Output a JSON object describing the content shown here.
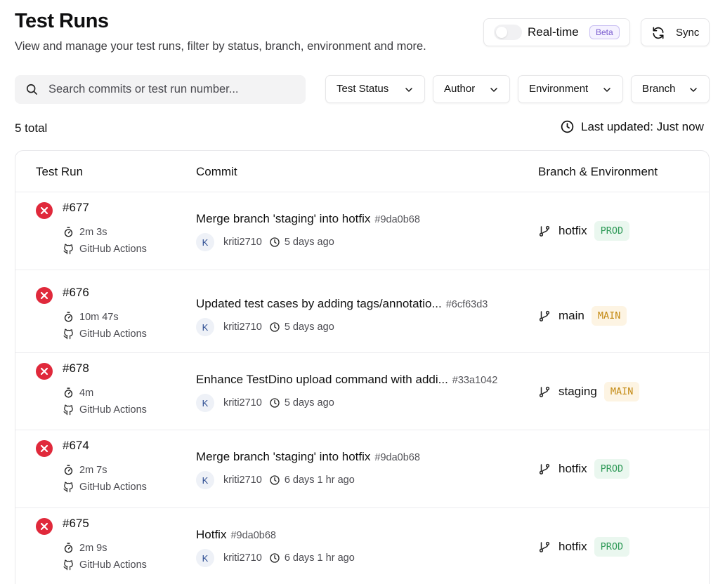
{
  "header": {
    "title": "Test Runs",
    "subtitle": "View and manage your test runs, filter by status, branch, environment and more."
  },
  "realtime": {
    "label": "Real-time",
    "badge": "Beta",
    "enabled": false
  },
  "sync": {
    "label": "Sync"
  },
  "search": {
    "placeholder": "Search commits or test run number..."
  },
  "filters": [
    "Test Status",
    "Author",
    "Environment",
    "Branch"
  ],
  "summary": {
    "total": "5 total",
    "last_updated": "Last updated: Just now"
  },
  "table": {
    "columns": [
      "Test Run",
      "Commit",
      "Branch & Environment"
    ],
    "rows": [
      {
        "run": "#677",
        "duration": "2m 3s",
        "provider": "GitHub Actions",
        "status": "failed",
        "commit_message": "Merge branch 'staging' into hotfix",
        "commit_hash": "#9da0b68",
        "author_initial": "K",
        "author": "kriti2710",
        "time": "5 days ago",
        "branch": "hotfix",
        "environment": "PROD"
      },
      {
        "run": "#676",
        "duration": "10m 47s",
        "provider": "GitHub Actions",
        "status": "failed",
        "commit_message": "Updated test cases by adding tags/annotatio...",
        "commit_hash": "#6cf63d3",
        "author_initial": "K",
        "author": "kriti2710",
        "time": "5 days ago",
        "branch": "main",
        "environment": "MAIN"
      },
      {
        "run": "#678",
        "duration": "4m",
        "provider": "GitHub Actions",
        "status": "failed",
        "commit_message": "Enhance TestDino upload command with addi...",
        "commit_hash": "#33a1042",
        "author_initial": "K",
        "author": "kriti2710",
        "time": "5 days ago",
        "branch": "staging",
        "environment": "MAIN"
      },
      {
        "run": "#674",
        "duration": "2m 7s",
        "provider": "GitHub Actions",
        "status": "failed",
        "commit_message": "Merge branch 'staging' into hotfix",
        "commit_hash": "#9da0b68",
        "author_initial": "K",
        "author": "kriti2710",
        "time": "6 days 1 hr ago",
        "branch": "hotfix",
        "environment": "PROD"
      },
      {
        "run": "#675",
        "duration": "2m 9s",
        "provider": "GitHub Actions",
        "status": "failed",
        "commit_message": "Hotfix",
        "commit_hash": "#9da0b68",
        "author_initial": "K",
        "author": "kriti2710",
        "time": "6 days 1 hr ago",
        "branch": "hotfix",
        "environment": "PROD"
      }
    ]
  },
  "colors": {
    "failed": "#e0293b",
    "prod_badge_bg": "#eaf7ef",
    "prod_badge_text": "#2f9a58",
    "main_badge_bg": "#fdf4e3",
    "main_badge_text": "#c48a13",
    "beta_badge_text": "#7a5ccf"
  },
  "icons": {
    "search": "search-icon",
    "sync": "refresh-icon",
    "filter": "chevron-down-icon",
    "updated": "clock-icon",
    "status": "x-circle-icon",
    "duration": "timer-icon",
    "provider": "github-icon",
    "time": "clock-icon",
    "branch": "git-branch-icon"
  }
}
